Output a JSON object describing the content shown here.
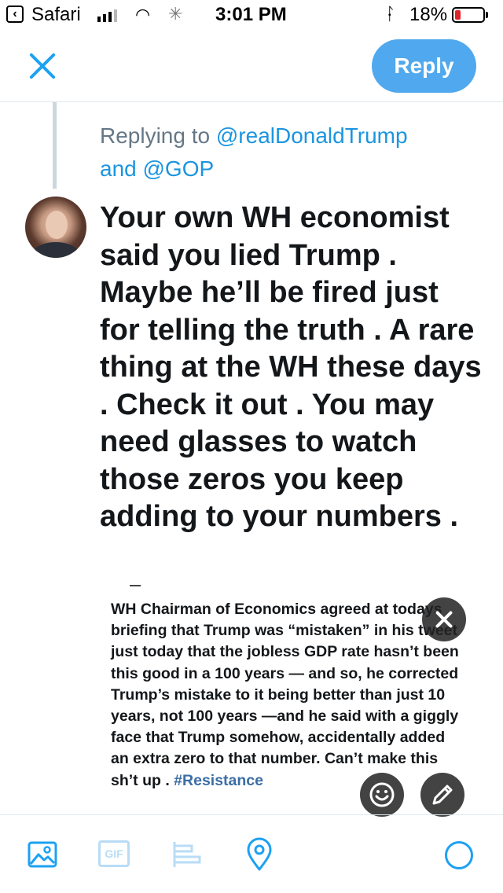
{
  "status_bar": {
    "back_app": "Safari",
    "time": "3:01 PM",
    "battery_percent": "18%",
    "icons": [
      "back-icon",
      "signal-icon",
      "wifi-icon",
      "activity-spinner-icon",
      "bluetooth-icon",
      "battery-icon"
    ]
  },
  "header": {
    "reply_label": "Reply",
    "icons": [
      "close-icon"
    ]
  },
  "replying_to": {
    "prefix": "Replying to",
    "handle_1": "@realDonaldTrump",
    "conjunction": "and",
    "handle_2": "@GOP"
  },
  "tweet": {
    "text": "Your own WH economist said you lied Trump . Maybe he’ll be fired just for telling the truth . A rare thing at the WH these days . Check it out . You may need glasses to watch those zeros you keep adding to your numbers ."
  },
  "attached_image": {
    "text": "WH Chairman of Economics agreed at todays briefing that Trump was “mistaken” in his tweet just today that the jobless GDP rate hasn’t been this good in a 100 years — and so, he corrected Trump’s mistake to it being better than just 10 years, not 100 years —and he said with a giggly face that Trump somehow, accidentally added an extra zero to that number. Can’t make this sh’t up .",
    "hashtag": "#Resistance",
    "icons": [
      "close-icon",
      "emoji-icon",
      "edit-pencil-icon"
    ]
  },
  "toolbar": {
    "gif_label": "GIF",
    "icons": [
      "image-icon",
      "gif-icon",
      "poll-icon",
      "location-icon",
      "character-count-ring-icon"
    ]
  },
  "colors": {
    "accent": "#1da1f2",
    "reply_button": "#50a9ee",
    "muted_text": "#657786",
    "battery_low": "#e0222b"
  }
}
